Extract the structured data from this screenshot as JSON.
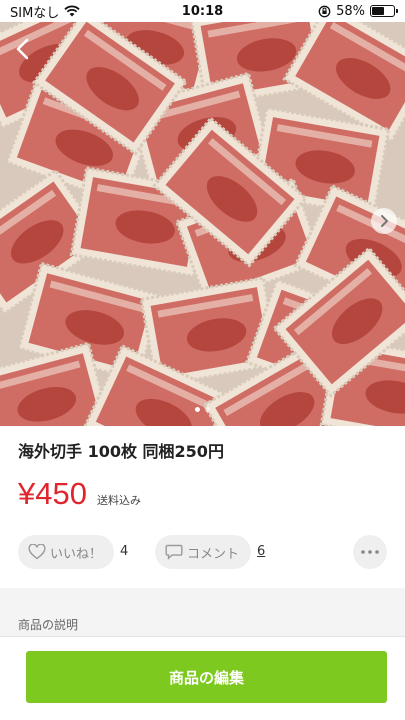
{
  "status_bar": {
    "carrier": "SIMなし",
    "time": "10:18",
    "battery_percent": "58%",
    "battery_level": 0.58
  },
  "item": {
    "title": "海外切手 100枚 同梱250円",
    "price": "¥450",
    "shipping_note": "送料込み"
  },
  "carousel": {
    "image_count": 2,
    "active_index": 0
  },
  "actions": {
    "like_label": "いいね！",
    "like_count": "4",
    "comment_label": "コメント",
    "comment_count": "6"
  },
  "description": {
    "header": "商品の説明"
  },
  "footer": {
    "edit_button_label": "商品の編集"
  },
  "colors": {
    "price": "#e0262c",
    "edit_button": "#7dc91f",
    "stamp": "#c9574f"
  }
}
